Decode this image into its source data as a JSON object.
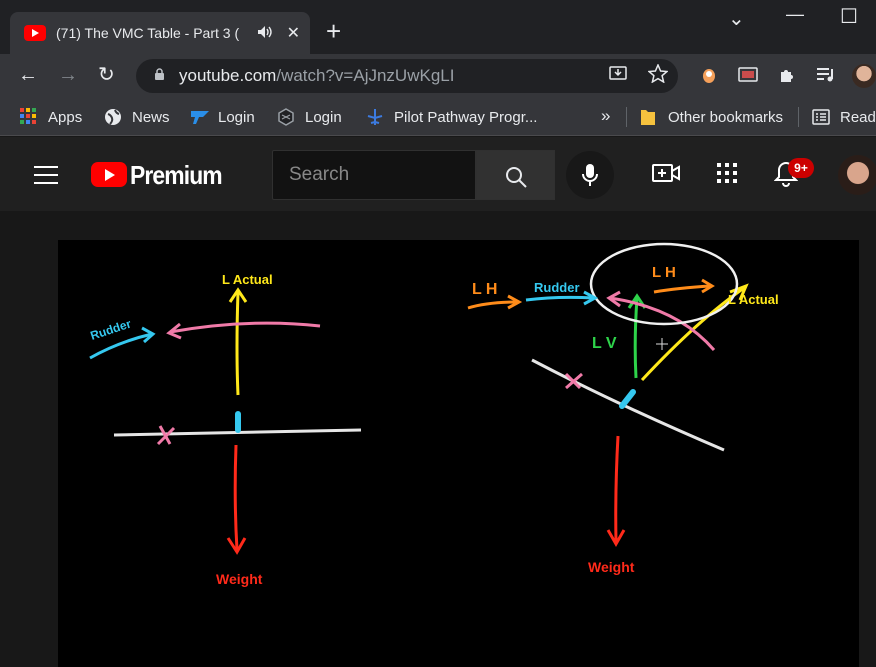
{
  "tab": {
    "title": "(71) The VMC Table - Part 3 (",
    "close": "✕"
  },
  "newtab": "+",
  "window": {
    "minimize": "—",
    "maximize": "☐",
    "dropdown": "⌄"
  },
  "toolbar": {
    "back": "←",
    "forward": "→",
    "reload": "↻",
    "url_host": "youtube.com",
    "url_path": "/watch?v=AjJnzUwKgLI"
  },
  "bookmarks": [
    {
      "label": "Apps",
      "icon": "apps-grid-icon"
    },
    {
      "label": "News",
      "icon": "globe-icon"
    },
    {
      "label": "Login",
      "icon": "login-blue-icon"
    },
    {
      "label": "Login",
      "icon": "login-dark-icon"
    },
    {
      "label": "Pilot Pathway Progr...",
      "icon": "plane-icon"
    }
  ],
  "bookmarks_overflow": "»",
  "other_bookmarks": "Other bookmarks",
  "reading_list": "Readi",
  "youtube": {
    "brand": "Premium",
    "search_placeholder": "Search",
    "notifications_badge": "9+"
  },
  "whiteboard": {
    "left": {
      "lift_label": "L Actual",
      "rudder_label": "Rudder",
      "weight_label": "Weight"
    },
    "right": {
      "lh_label": "L H",
      "rudder_label": "Rudder",
      "lh_circled_label": "L H",
      "lactual_label": "L Actual",
      "lv_label": "L V",
      "weight_label": "Weight"
    }
  },
  "colors": {
    "yt_red": "#ff0000",
    "ink_yellow": "#ffe81a",
    "ink_pink": "#f07aa8",
    "ink_cyan": "#35c8ef",
    "ink_red": "#ff2a1a",
    "ink_orange": "#ff8c1a",
    "ink_green": "#2ed34a",
    "ink_white": "#e6e6e6"
  }
}
